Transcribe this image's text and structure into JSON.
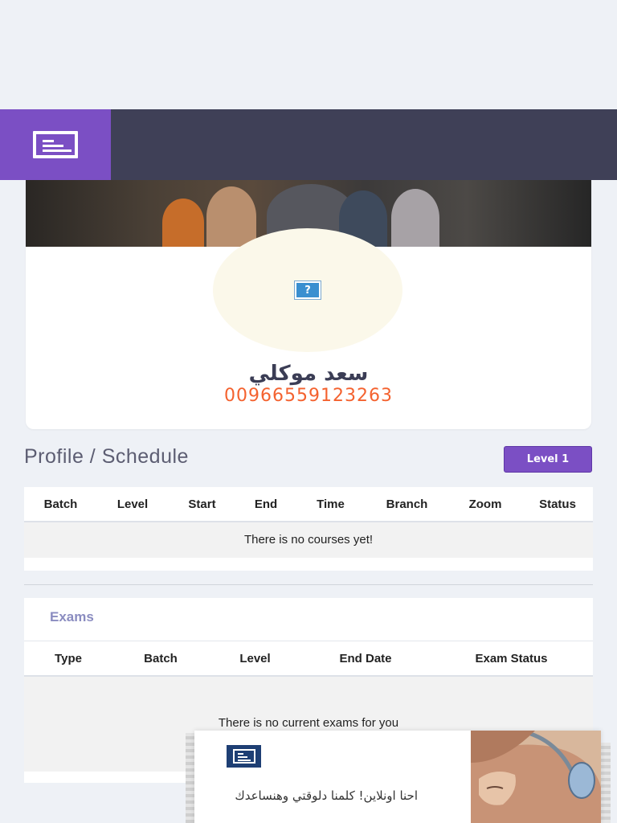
{
  "topbar": {
    "menu_icon": "menu-icon"
  },
  "profile": {
    "name": "سعد موكلي",
    "phone": "00966559123263",
    "avatar_missing_icon": "?"
  },
  "page": {
    "title": "Profile / Schedule",
    "level_button": "Level 1"
  },
  "schedule": {
    "columns": [
      "Batch",
      "Level",
      "Start",
      "End",
      "Time",
      "Branch",
      "Zoom",
      "Status"
    ],
    "empty_message": "There is no courses yet!"
  },
  "exams": {
    "title": "Exams",
    "columns": [
      "Type",
      "Batch",
      "Level",
      "End Date",
      "Exam Status"
    ],
    "empty_message": "There is no current exams for you"
  },
  "chat": {
    "message": "احنا اونلاين! كلمنا دلوقتي وهنساعدك"
  },
  "colors": {
    "accent": "#7b4fc4",
    "topbar": "#3f4057",
    "phone": "#f4622f",
    "exams_title": "#8a8cc0"
  }
}
